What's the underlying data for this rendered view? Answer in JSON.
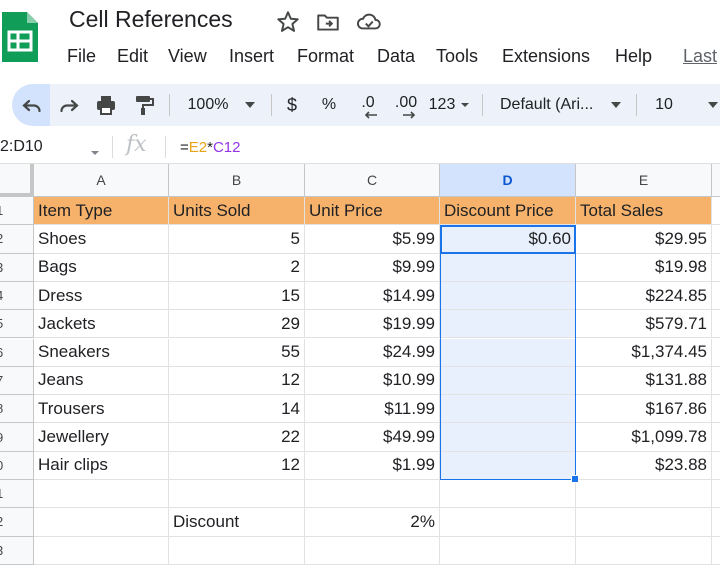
{
  "app": {
    "title": "Cell References",
    "brand_color": "#0f9d58"
  },
  "menu": {
    "items": [
      "File",
      "Edit",
      "View",
      "Insert",
      "Format",
      "Data",
      "Tools",
      "Extensions",
      "Help"
    ],
    "last_edit": "Last"
  },
  "toolbar": {
    "zoom": "100%",
    "currency": "$",
    "percent": "%",
    "decrease_decimal": ".0",
    "increase_decimal": ".00",
    "more_formats": "123",
    "font": "Default (Ari...",
    "font_size": "10"
  },
  "formula_bar": {
    "name_box": "2:D10",
    "fx": "fx",
    "formula_prefix": "=",
    "formula_ref1": "E2",
    "formula_op": "*",
    "formula_ref2": "C12"
  },
  "grid": {
    "columns": [
      "A",
      "B",
      "C",
      "D",
      "E"
    ],
    "selected_column": "D",
    "rows": [
      "1",
      "2",
      "3",
      "4",
      "5",
      "6",
      "7",
      "8",
      "9",
      "0",
      "1",
      "2",
      "3"
    ],
    "header_row": [
      "Item Type",
      "Units Sold",
      "Unit Price",
      "Discount Price",
      "Total Sales"
    ],
    "data": [
      [
        "Shoes",
        "5",
        "$5.99",
        "$0.60",
        "$29.95"
      ],
      [
        "Bags",
        "2",
        "$9.99",
        "",
        "$19.98"
      ],
      [
        "Dress",
        "15",
        "$14.99",
        "",
        "$224.85"
      ],
      [
        "Jackets",
        "29",
        "$19.99",
        "",
        "$579.71"
      ],
      [
        "Sneakers",
        "55",
        "$24.99",
        "",
        "$1,374.45"
      ],
      [
        "Jeans",
        "12",
        "$10.99",
        "",
        "$131.88"
      ],
      [
        "Trousers",
        "14",
        "$11.99",
        "",
        "$167.86"
      ],
      [
        "Jewellery",
        "22",
        "$49.99",
        "",
        "$1,099.78"
      ],
      [
        "Hair clips",
        "12",
        "$1.99",
        "",
        "$23.88"
      ]
    ],
    "discount_label": "Discount",
    "discount_value": "2%",
    "header_fill": "#f6b26b",
    "selection_color": "#1a73e8"
  }
}
